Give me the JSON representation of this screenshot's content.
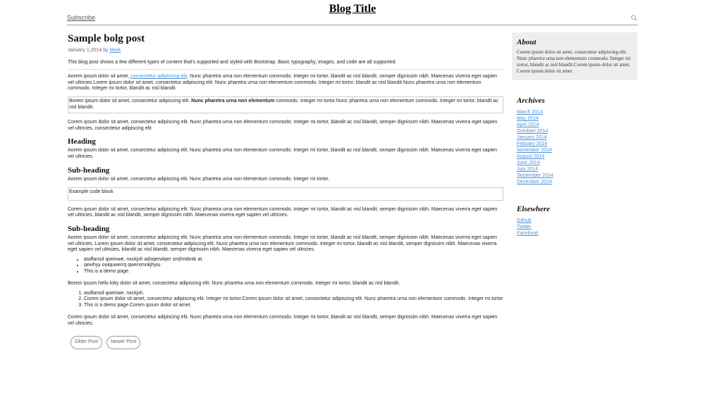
{
  "header": {
    "site_title": "Blog Title",
    "subscribe": "Subscribe",
    "search_icon": "search-icon"
  },
  "post": {
    "title": "Sample bolg post",
    "date": "January 1,2014",
    "by": "by",
    "author": "Mark",
    "intro": "This blog post shows a few different types of content that's supported and styled with Bootstrap. Basic typography, images, and code are all supported.",
    "p1_before": "Aorem ipsum dolor sit amet,",
    "p1_link": "consectetur adipiscing elit",
    "p1_after": ". Nunc pharetra urna non elementum commodo. Integer mi tortor, blandit ac nisl blandit, semper dignissim nibh. Maecenas viverra eget sapien vel ultricies.Lorem ipsum dolor sit amet, consectetur adipiscing elit. Nunc pharetra urna non elementum commodo. Integer mi tortor, blandit ac nisl blandit.Nunc pharetra urna non elementum commodo. Integer mi tortor, blandit ac nisl blandit.",
    "quote_before": "Borem ipsum dolor sit amet, consectetur adipiscing elit.",
    "quote_bold": "Nunc pharetra urna non elementum",
    "quote_after": "commodo. Integer mi tortor.Nunc pharetra urna non elementum commodo. Integer mi tortor, blandit ac nisl blandit.",
    "p2": "Corem ipsum dolor sit amet, consectetur adipiscing elit. Nunc pharetra urna non elementum commodo. Integer mi tortor, blandit ac nisl blandit, semper dignissim nibh. Maecenas viverra eget sapien vel ultricies, consectetur adipiscing elit.",
    "heading": "Heading",
    "p3": "Aorem ipsum dolor sit amet, consectetur adipiscing elit. Nunc pharetra urna non elementum commodo. Integer mi tortor, blandit ac nisl blandit, semper dignissim nibh. Maecenas viverra eget sapien vel ultricies.",
    "subheading1": "Sub-heading",
    "p4": "Aorem ipsum dolor sit amet, consectetur adipiscing elit. Nunc pharetra urna non elementum commodo. Integer mi tortor.",
    "code": "Example code block",
    "p5": "Corem ipsum dolor sit amet, consectetur adipiscing elit. Nunc pharetra urna non elementum commodo. Integer mi tortor, blandit ac nisl blandit, semper dignissim nibh. Maecenas viverra eget sapien vel ultricies, blandit ac nisl blandit, semper dignissim nibh. Maecenas viverra eget sapien vel ultricies.",
    "subheading2": "Sub-heading",
    "p6": "Aorem ipsum dolor sit amet, consectetur adipiscing elit. Nunc pharetra urna non elementum commodo. Integer mi tortor, blandit ac nisl blandit, semper dignissim nibh. Maecenas viverra eget sapien vel ultricies. Lorem ipsum dolor sit amet, consectetur adipiscing elit. Nunc pharetra urna non elementum commodo. Integer mi tortor, blandit ac nisl blandit, semper dignissim nibh. Maecenas viverra eget sapien vel ultricies, blandit ac nisl blandit, semper dignissim nibh. Maecenas viverra eget sapien vel ultricies.",
    "ul": [
      "asdfansd qoeinwe, nxckjvh adsqerwlqer smjhmbntk at.",
      "qewhyy ooiquwerrq qwerxmnkjhyiu.",
      "This is a demo page."
    ],
    "p7": "Borem ipsum hello kitty dolor sit amet, consectetur adipiscing elit. Nunc pharetra urna non elementum commodo. Integer mi tortor, blandit ac nisl blandit.",
    "ol": [
      "asdfansd qoeinwe, nxckjvh.",
      "Corem ipsum dolor sit amet, consectetur adipiscing elit. Integer mi tortor.Corem ipsum dolor sit amet, consectetur adipiscing elit. Nunc pharetra urna non elementum commodo. Integer mi tortor",
      "This is a demo page.Corem ipsum dolor sit amet."
    ],
    "p8": "Corem ipsum dolor sit amet, consectetur adipiscing elit. Nunc pharetra urna non elementum commodo. Integer mi tortor, blandit ac nisl blandit, semper dignissim nibh. Maecenas viverra eget sapien vel ultricies.",
    "older": "Older Post",
    "newer": "Newer Post"
  },
  "sidebar": {
    "about_title": "About",
    "about_text": "Corem ipsum dolor sit amet, consectetur adipiscing elit. Nunc pharetra urna non elementum commodo. Integer mi tortor, blandit ac nisl blandit.Corem ipsum dolor sit amet, Corem ipsum dolor sit amet.",
    "archives_title": "Archives",
    "archives": [
      "March 2014",
      "May 2014",
      "April 2014",
      "Octobter 2014",
      "January 2014",
      "Febuary 2014",
      "November 2014",
      "August 2014",
      "June 2014",
      "July 2014",
      "September 2014",
      "December 2014"
    ],
    "elsewhere_title": "Elsewhere",
    "elsewhere": [
      "Github",
      "Twitter",
      "Facebook"
    ]
  },
  "colors": {
    "link": "#4a90d9",
    "sidebar_bg": "#eeeeee"
  }
}
